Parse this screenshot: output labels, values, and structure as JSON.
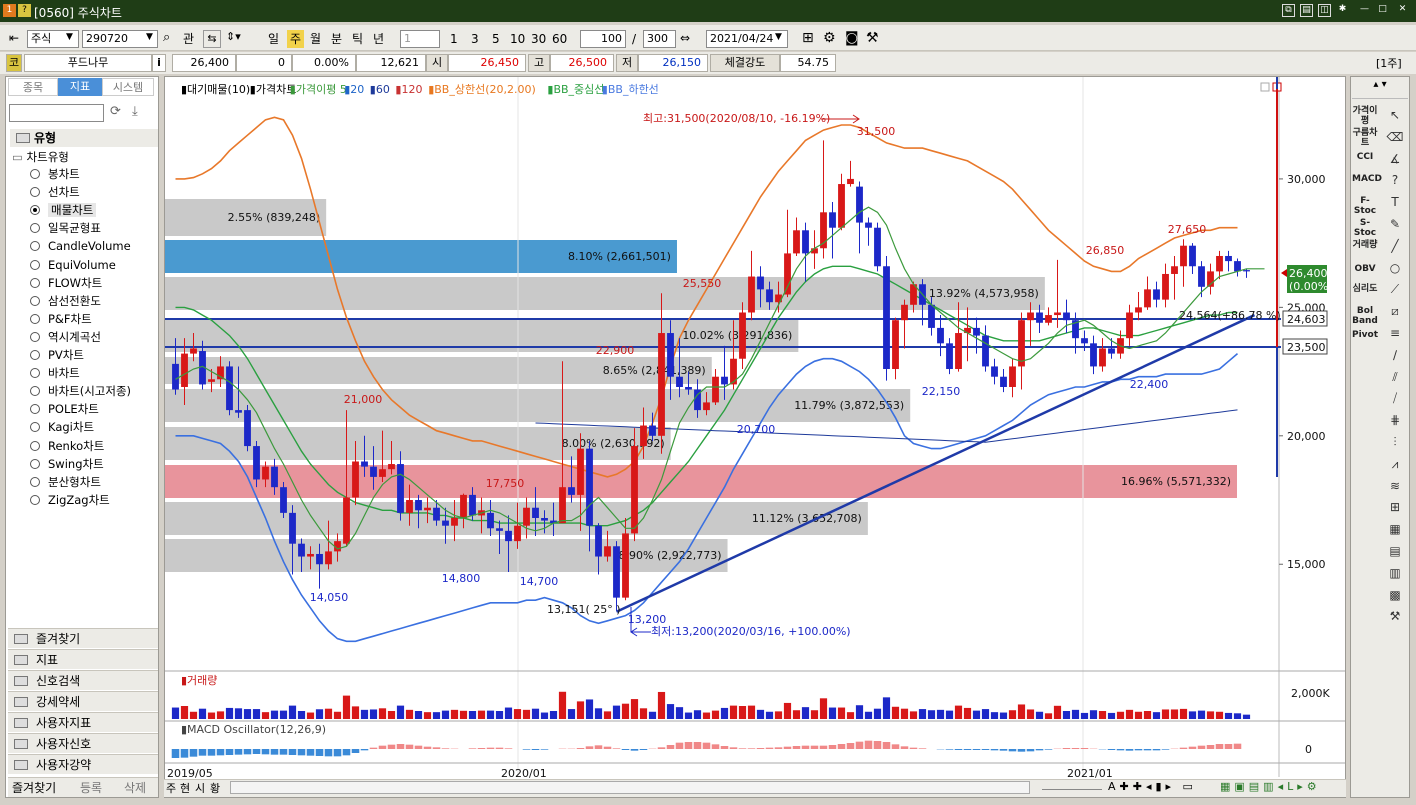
{
  "window": {
    "title": "[0560] 주식차트",
    "icon_a": "1",
    "icon_b": "?"
  },
  "toolbar": {
    "market": "주식",
    "code": "290720",
    "lookup": "관",
    "periods": [
      "일",
      "주",
      "월",
      "분",
      "틱",
      "년"
    ],
    "active_period": "주",
    "interval": "1",
    "intervals": [
      "1",
      "3",
      "5",
      "10",
      "30",
      "60"
    ],
    "count": "100",
    "slash": "/",
    "total": "300",
    "date": "2021/04/24",
    "unit": "[1주]"
  },
  "quote": {
    "ko": "코",
    "name": "푸드나무",
    "info": "i",
    "price": "26,400",
    "change": "0",
    "rate": "0.00%",
    "volume": "12,621",
    "open_label": "시",
    "open": "26,450",
    "high_label": "고",
    "high": "26,500",
    "low_label": "저",
    "low": "26,150",
    "strength_label": "체결강도",
    "strength": "54.75"
  },
  "left_panel": {
    "tabs": [
      "종목",
      "지표",
      "시스템"
    ],
    "active_tab": "지표",
    "section": "유형",
    "tree_root": "차트유형",
    "chart_types": [
      "봉차트",
      "선차트",
      "매물차트",
      "일목균형표",
      "CandleVolume",
      "EquiVolume",
      "FLOW차트",
      "삼선전환도",
      "P&F차트",
      "역시계곡선",
      "PV차트",
      "바차트",
      "바차트(시고저종)",
      "POLE차트",
      "Kagi차트",
      "Renko차트",
      "Swing차트",
      "분산형차트",
      "ZigZag차트"
    ],
    "selected_type": "매물차트",
    "categories": [
      "즐겨찾기",
      "지표",
      "신호검색",
      "강세약세",
      "사용자지표",
      "사용자신호",
      "사용자강약"
    ],
    "bottom_buttons": [
      "즐겨찾기",
      "등록",
      "삭제"
    ]
  },
  "bottom_tabs": [
    "주",
    "현",
    "시",
    "황"
  ],
  "legend": [
    "▮대기매물(10)",
    "▮가격차트",
    "▮가격이평 5",
    "▮20",
    "▮60",
    "▮120",
    "▮BB_상한선(20,2.00)",
    "▮BB_중심선",
    "▮BB_하한선"
  ],
  "legend_colors": [
    "#000000",
    "#000000",
    "#3c9a3c",
    "#1e64c8",
    "#1e3a9a",
    "#c83232",
    "#e87820",
    "#2aa040",
    "#4a7ae0"
  ],
  "volume_label": "▮거래량",
  "volume_axis": "2,000K",
  "macd_label": "▮MACD Oscillator(12,26,9)",
  "macd_axis": "0",
  "x_ticks": [
    "2019/05",
    "2020/01",
    "2021/01"
  ],
  "y_ticks": [
    "30,000",
    "25,000",
    "20,000",
    "15,000"
  ],
  "price_tags": {
    "current": "26,400",
    "current_rate": "(0.00%)",
    "level1": "24,603",
    "level2": "23,500"
  },
  "annotations": {
    "high_text": "최고:31,500(2020/08/10, -16.19%)",
    "low_text": "최저:13,200(2020/03/16, +100.00%)",
    "trend_text": "13,151( 25° )",
    "trend_label": "24,564(+86.78 %)",
    "labels": [
      "31,500",
      "27,650",
      "26,850",
      "25,550",
      "22,900",
      "22,150",
      "22,400",
      "21,000",
      "20,700",
      "17,750",
      "14,050",
      "14,800",
      "14,700",
      "13,200"
    ]
  },
  "volume_profile": [
    {
      "text": "2.55% (839,248)",
      "pct": 2.55
    },
    {
      "text": "8.10% (2,661,501)",
      "pct": 8.1
    },
    {
      "text": "13.92% (4,573,958)",
      "pct": 13.92
    },
    {
      "text": "10.02% (3,291,836)",
      "pct": 10.02
    },
    {
      "text": "8.65% (2,841,389)",
      "pct": 8.65
    },
    {
      "text": "11.79% (3,872,553)",
      "pct": 11.79
    },
    {
      "text": "8.00% (2,630,392)",
      "pct": 8.0
    },
    {
      "text": "16.96% (5,571,332)",
      "pct": 16.96
    },
    {
      "text": "11.12% (3,652,708)",
      "pct": 11.12
    },
    {
      "text": "8.90% (2,922,773)",
      "pct": 8.9
    }
  ],
  "right_indicators": [
    "가격이평",
    "구름차트",
    "CCI",
    "MACD",
    "F-Stoc",
    "S-Stoc",
    "거래량",
    "OBV",
    "심리도",
    "Bol Band",
    "Pivot"
  ],
  "chart_data": {
    "type": "candlestick",
    "y_range": [
      11000,
      33500
    ],
    "period": "weekly",
    "start": "2019/05",
    "end": "2021/04",
    "summary": {
      "high": 31500,
      "low": 13200,
      "last": 26400
    },
    "candles": [
      [
        22800,
        21800,
        23800,
        21600
      ],
      [
        21900,
        23200,
        23800,
        21200
      ],
      [
        23200,
        23400,
        24000,
        22900
      ],
      [
        23300,
        22000,
        23700,
        21800
      ],
      [
        22100,
        22200,
        22600,
        21700
      ],
      [
        22200,
        22700,
        23100,
        21900
      ],
      [
        22700,
        21000,
        22900,
        20800
      ],
      [
        21000,
        20900,
        22700,
        20700
      ],
      [
        21000,
        19600,
        21200,
        19400
      ],
      [
        19600,
        18300,
        19800,
        18000
      ],
      [
        18300,
        18800,
        19000,
        18000
      ],
      [
        18800,
        18000,
        19100,
        17700
      ],
      [
        18000,
        17000,
        18200,
        16800
      ],
      [
        17000,
        15800,
        17300,
        14600
      ],
      [
        15800,
        15300,
        16000,
        14700
      ],
      [
        15300,
        15400,
        15700,
        14800
      ],
      [
        15400,
        15000,
        15800,
        14050
      ],
      [
        15000,
        15500,
        16700,
        14800
      ],
      [
        15500,
        15900,
        16200,
        15100
      ],
      [
        15800,
        17600,
        21000,
        15700
      ],
      [
        17600,
        19000,
        19800,
        17300
      ],
      [
        19000,
        18800,
        20000,
        18400
      ],
      [
        18800,
        18400,
        19600,
        17900
      ],
      [
        18400,
        18700,
        20200,
        18200
      ],
      [
        18700,
        18900,
        19800,
        18500
      ],
      [
        18900,
        17000,
        19400,
        16700
      ],
      [
        17000,
        17500,
        18100,
        16500
      ],
      [
        17500,
        17100,
        17700,
        16400
      ],
      [
        17100,
        17200,
        17600,
        16600
      ],
      [
        17200,
        16700,
        17500,
        16500
      ],
      [
        16700,
        16500,
        17200,
        15800
      ],
      [
        16500,
        16800,
        17500,
        15900
      ],
      [
        16800,
        17700,
        17750,
        16400
      ],
      [
        17700,
        16900,
        18000,
        16700
      ],
      [
        16900,
        17100,
        17600,
        16200
      ],
      [
        17000,
        16400,
        17500,
        16100
      ],
      [
        16400,
        16300,
        16700,
        15400
      ],
      [
        16300,
        15900,
        16900,
        14700
      ],
      [
        15900,
        16500,
        17400,
        15600
      ],
      [
        16500,
        17200,
        17600,
        16000
      ],
      [
        17200,
        16800,
        18000,
        16100
      ],
      [
        16800,
        16700,
        17100,
        16200
      ],
      [
        16700,
        16600,
        17400,
        16100
      ],
      [
        16600,
        18000,
        22900,
        16600
      ],
      [
        18000,
        17700,
        19200,
        17400
      ],
      [
        17700,
        19500,
        20100,
        16300
      ],
      [
        19500,
        16500,
        19800,
        15500
      ],
      [
        16500,
        15300,
        16600,
        14600
      ],
      [
        15300,
        15700,
        16300,
        15100
      ],
      [
        15700,
        13700,
        15900,
        13200
      ],
      [
        13700,
        16200,
        16800,
        13600
      ],
      [
        16200,
        19600,
        20300,
        15900
      ],
      [
        19600,
        20400,
        21100,
        19100
      ],
      [
        20400,
        20000,
        20900,
        19800
      ],
      [
        20000,
        24000,
        25550,
        19300
      ],
      [
        24000,
        22300,
        24500,
        21400
      ],
      [
        22300,
        21900,
        23800,
        21500
      ],
      [
        21900,
        21800,
        22500,
        21600
      ],
      [
        21800,
        21000,
        22200,
        20700
      ],
      [
        21000,
        21300,
        21700,
        20800
      ],
      [
        21300,
        22300,
        22600,
        21200
      ],
      [
        22300,
        22000,
        23500,
        21400
      ],
      [
        22000,
        23000,
        24500,
        21800
      ],
      [
        23000,
        24800,
        25200,
        22600
      ],
      [
        24800,
        26200,
        27200,
        24500
      ],
      [
        26200,
        25700,
        26600,
        25000
      ],
      [
        25700,
        25200,
        26000,
        24900
      ],
      [
        25200,
        25500,
        26000,
        24800
      ],
      [
        25500,
        27100,
        28800,
        25400
      ],
      [
        27100,
        28000,
        28500,
        27000
      ],
      [
        28000,
        27100,
        28300,
        26000
      ],
      [
        27100,
        27300,
        28000,
        26500
      ],
      [
        27300,
        28700,
        31500,
        26900
      ],
      [
        28700,
        28100,
        29100,
        26900
      ],
      [
        28100,
        29800,
        30200,
        28000
      ],
      [
        29800,
        30000,
        30700,
        29700
      ],
      [
        29700,
        28300,
        29900,
        27100
      ],
      [
        28300,
        28100,
        28500,
        27400
      ],
      [
        28100,
        26600,
        28300,
        26400
      ],
      [
        26600,
        22600,
        27000,
        22150
      ],
      [
        22600,
        24500,
        24600,
        22200
      ],
      [
        24500,
        25100,
        25300,
        23400
      ],
      [
        25100,
        25900,
        26000,
        24800
      ],
      [
        25900,
        25100,
        26100,
        24300
      ],
      [
        25100,
        24200,
        25400,
        23900
      ],
      [
        24200,
        23600,
        24700,
        23100
      ],
      [
        23600,
        22600,
        23800,
        22400
      ],
      [
        22600,
        24000,
        25200,
        22500
      ],
      [
        24000,
        24200,
        25000,
        22900
      ],
      [
        24200,
        23900,
        24600,
        23200
      ],
      [
        23900,
        22700,
        24300,
        22500
      ],
      [
        22700,
        22300,
        23000,
        22000
      ],
      [
        22300,
        21900,
        22600,
        21700
      ],
      [
        21900,
        22700,
        23000,
        21500
      ],
      [
        22700,
        24500,
        24800,
        21800
      ],
      [
        24500,
        24800,
        25200,
        23500
      ],
      [
        24800,
        24400,
        25100,
        24000
      ],
      [
        24400,
        24700,
        25000,
        24300
      ],
      [
        24700,
        24800,
        26850,
        24200
      ],
      [
        24800,
        24500,
        25300,
        24000
      ],
      [
        24500,
        23800,
        24800,
        23200
      ],
      [
        23800,
        23600,
        24100,
        23300
      ],
      [
        23600,
        22700,
        23900,
        22400
      ],
      [
        22700,
        23400,
        23800,
        22500
      ],
      [
        23400,
        23200,
        23800,
        23000
      ],
      [
        23200,
        23800,
        24100,
        23000
      ],
      [
        23800,
        24800,
        25100,
        23500
      ],
      [
        24800,
        25000,
        25600,
        24500
      ],
      [
        25000,
        25700,
        26200,
        24900
      ],
      [
        25700,
        25300,
        26000,
        25000
      ],
      [
        25300,
        26300,
        26700,
        25000
      ],
      [
        26300,
        26600,
        27000,
        25300
      ],
      [
        26600,
        27400,
        27650,
        25800
      ],
      [
        27400,
        26600,
        27500,
        26300
      ],
      [
        26600,
        25800,
        26800,
        25400
      ],
      [
        25800,
        26400,
        26700,
        25500
      ],
      [
        26400,
        27000,
        27200,
        26100
      ],
      [
        27000,
        26800,
        27200,
        26400
      ],
      [
        26800,
        26400,
        26900,
        26200
      ],
      [
        26450,
        26400,
        26500,
        26150
      ]
    ],
    "ma5": [
      22200,
      22400,
      22600,
      22700,
      22500,
      22300,
      22100,
      21800,
      21400,
      20900,
      20200,
      19500,
      18900,
      18200,
      17500,
      16900,
      16400,
      15900,
      15600,
      15700,
      16200,
      16900,
      17600,
      18100,
      18400,
      18500,
      18300,
      18000,
      17700,
      17400,
      17100,
      16900,
      16800,
      16900,
      17000,
      17100,
      17000,
      16800,
      16600,
      16400,
      16300,
      16400,
      16600,
      16700,
      16700,
      16900,
      17300,
      17600,
      17200,
      16800,
      16400,
      16400,
      16800,
      17500,
      18300,
      19400,
      20500,
      21100,
      21600,
      21900,
      21900,
      21900,
      22100,
      22400,
      23000,
      23700,
      24400,
      25100,
      25800,
      26500,
      27000,
      27300,
      27500,
      27800,
      28100,
      28400,
      28700,
      28900,
      28700,
      28200,
      27300,
      26500,
      25900,
      25500,
      25100,
      24800,
      24500,
      24200,
      24000,
      23800,
      23600,
      23400,
      23200,
      23000,
      22900,
      23000,
      23300,
      23600,
      24000,
      24300,
      24400,
      24500,
      24300,
      24000,
      23700,
      23500,
      23400,
      23500,
      23600,
      23700,
      24000,
      24400,
      24800,
      25200,
      25600,
      25900,
      26200,
      26300,
      26400,
      26500,
      26500,
      26500
    ],
    "bb_upper": [
      30000,
      30000,
      30050,
      30200,
      30400,
      30700,
      31100,
      31400,
      31700,
      32000,
      32300,
      32400,
      32300,
      31700,
      30800,
      29600,
      28300,
      27000,
      25700,
      24600,
      23700,
      22900,
      22300,
      21800,
      21400,
      21100,
      20800,
      20600,
      20400,
      20200,
      20100,
      20000,
      19900,
      19800,
      19800,
      19700,
      19600,
      19500,
      19400,
      19300,
      19200,
      19100,
      19000,
      18900,
      18800,
      18700,
      18600,
      18500,
      18400,
      18500,
      18700,
      19000,
      19600,
      20500,
      21500,
      22700,
      23800,
      24500,
      25100,
      25700,
      26300,
      26900,
      27500,
      28100,
      28700,
      29300,
      29800,
      30300,
      30700,
      31100,
      31500,
      31700,
      31900,
      32000,
      32100,
      32100,
      32000,
      31800,
      31600,
      31400,
      31300,
      31200,
      31200,
      31200,
      31100,
      31000,
      30900,
      30800,
      30700,
      30500,
      30300,
      30100,
      29900,
      29600,
      29200,
      28800,
      28400,
      28000,
      27700,
      27400,
      27100,
      26800,
      26600,
      26500,
      26400,
      26400,
      26600,
      26900,
      27100,
      27300,
      27500,
      27700,
      27800,
      27900,
      28000,
      28000,
      28100,
      28100,
      28100
    ],
    "bb_mid": [
      25000,
      25000,
      24900,
      24700,
      24500,
      24200,
      23900,
      23500,
      23000,
      22400,
      21800,
      21200,
      20600,
      20000,
      19400,
      18900,
      18500,
      18100,
      17800,
      17600,
      17400,
      17300,
      17200,
      17100,
      17100,
      17000,
      17000,
      17000,
      17000,
      16900,
      16900,
      16800,
      16800,
      16700,
      16700,
      16700,
      16600,
      16600,
      16600,
      16600,
      16600,
      16600,
      16600,
      16600,
      16600,
      16600,
      16500,
      16500,
      16500,
      16600,
      16700,
      16900,
      17100,
      17400,
      17800,
      18200,
      18600,
      19000,
      19500,
      20000,
      20500,
      21000,
      21600,
      22200,
      22800,
      23400,
      24000,
      24600,
      25100,
      25600,
      26000,
      26300,
      26500,
      26600,
      26600,
      26600,
      26500,
      26400,
      26300,
      26100,
      25900,
      25700,
      25500,
      25300,
      25100,
      24900,
      24700,
      24500,
      24300,
      24100,
      23900,
      23800,
      23700,
      23700,
      23700,
      23700,
      23700,
      23800,
      23900,
      24000,
      24100,
      24200,
      24200,
      24100,
      24000,
      23900,
      23900,
      23900,
      24000,
      24100,
      24200,
      24300,
      24400,
      24500,
      24600,
      24700,
      24700,
      24800,
      24800
    ],
    "bb_lower": [
      20000,
      20000,
      20000,
      19900,
      19800,
      19700,
      19400,
      19000,
      18400,
      17600,
      16800,
      15900,
      15100,
      14400,
      13800,
      13300,
      12800,
      12400,
      12100,
      12000,
      12000,
      12100,
      12200,
      12300,
      12400,
      12500,
      12600,
      12700,
      12800,
      12900,
      13000,
      13100,
      13200,
      13300,
      13400,
      13500,
      13500,
      13500,
      13500,
      13600,
      13600,
      13700,
      13600,
      13500,
      13300,
      13000,
      12800,
      12700,
      12800,
      12900,
      13000,
      13200,
      13500,
      13900,
      14300,
      14700,
      15100,
      15600,
      16200,
      16800,
      17400,
      18000,
      18700,
      19300,
      19900,
      20500,
      21100,
      21600,
      22000,
      22400,
      22700,
      22900,
      23000,
      23000,
      22900,
      22700,
      22500,
      22200,
      21800,
      21300,
      20700,
      20000,
      19700,
      19600,
      19500,
      19500,
      19600,
      19700,
      19800,
      19900,
      20000,
      20200,
      20400,
      20600,
      20900,
      21200,
      21400,
      21600,
      21700,
      21800,
      21900,
      21900,
      22000,
      22100,
      22100,
      22200,
      22200,
      22300,
      22300,
      22300,
      22400,
      22400,
      22400,
      22400,
      22400,
      22500,
      22600,
      22900,
      23200
    ]
  }
}
